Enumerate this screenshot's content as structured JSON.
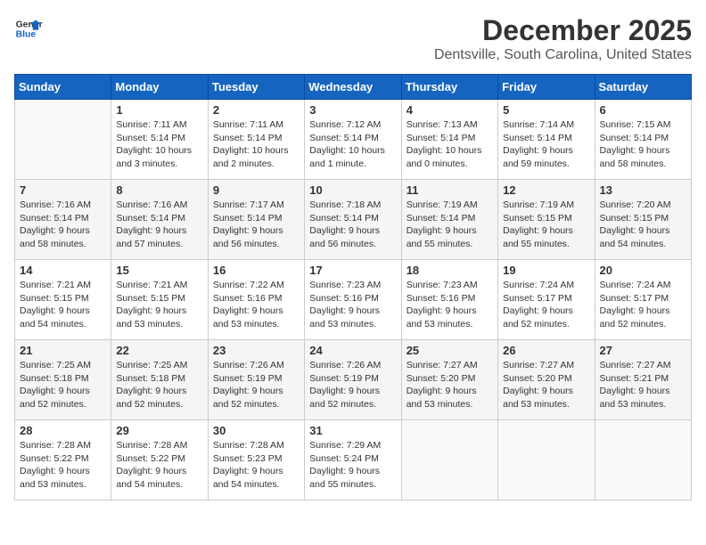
{
  "header": {
    "logo_line1": "General",
    "logo_line2": "Blue",
    "month": "December 2025",
    "location": "Dentsville, South Carolina, United States"
  },
  "days_of_week": [
    "Sunday",
    "Monday",
    "Tuesday",
    "Wednesday",
    "Thursday",
    "Friday",
    "Saturday"
  ],
  "weeks": [
    [
      {
        "day": "",
        "info": ""
      },
      {
        "day": "1",
        "info": "Sunrise: 7:11 AM\nSunset: 5:14 PM\nDaylight: 10 hours\nand 3 minutes."
      },
      {
        "day": "2",
        "info": "Sunrise: 7:11 AM\nSunset: 5:14 PM\nDaylight: 10 hours\nand 2 minutes."
      },
      {
        "day": "3",
        "info": "Sunrise: 7:12 AM\nSunset: 5:14 PM\nDaylight: 10 hours\nand 1 minute."
      },
      {
        "day": "4",
        "info": "Sunrise: 7:13 AM\nSunset: 5:14 PM\nDaylight: 10 hours\nand 0 minutes."
      },
      {
        "day": "5",
        "info": "Sunrise: 7:14 AM\nSunset: 5:14 PM\nDaylight: 9 hours\nand 59 minutes."
      },
      {
        "day": "6",
        "info": "Sunrise: 7:15 AM\nSunset: 5:14 PM\nDaylight: 9 hours\nand 58 minutes."
      }
    ],
    [
      {
        "day": "7",
        "info": "Sunrise: 7:16 AM\nSunset: 5:14 PM\nDaylight: 9 hours\nand 58 minutes."
      },
      {
        "day": "8",
        "info": "Sunrise: 7:16 AM\nSunset: 5:14 PM\nDaylight: 9 hours\nand 57 minutes."
      },
      {
        "day": "9",
        "info": "Sunrise: 7:17 AM\nSunset: 5:14 PM\nDaylight: 9 hours\nand 56 minutes."
      },
      {
        "day": "10",
        "info": "Sunrise: 7:18 AM\nSunset: 5:14 PM\nDaylight: 9 hours\nand 56 minutes."
      },
      {
        "day": "11",
        "info": "Sunrise: 7:19 AM\nSunset: 5:14 PM\nDaylight: 9 hours\nand 55 minutes."
      },
      {
        "day": "12",
        "info": "Sunrise: 7:19 AM\nSunset: 5:15 PM\nDaylight: 9 hours\nand 55 minutes."
      },
      {
        "day": "13",
        "info": "Sunrise: 7:20 AM\nSunset: 5:15 PM\nDaylight: 9 hours\nand 54 minutes."
      }
    ],
    [
      {
        "day": "14",
        "info": "Sunrise: 7:21 AM\nSunset: 5:15 PM\nDaylight: 9 hours\nand 54 minutes."
      },
      {
        "day": "15",
        "info": "Sunrise: 7:21 AM\nSunset: 5:15 PM\nDaylight: 9 hours\nand 53 minutes."
      },
      {
        "day": "16",
        "info": "Sunrise: 7:22 AM\nSunset: 5:16 PM\nDaylight: 9 hours\nand 53 minutes."
      },
      {
        "day": "17",
        "info": "Sunrise: 7:23 AM\nSunset: 5:16 PM\nDaylight: 9 hours\nand 53 minutes."
      },
      {
        "day": "18",
        "info": "Sunrise: 7:23 AM\nSunset: 5:16 PM\nDaylight: 9 hours\nand 53 minutes."
      },
      {
        "day": "19",
        "info": "Sunrise: 7:24 AM\nSunset: 5:17 PM\nDaylight: 9 hours\nand 52 minutes."
      },
      {
        "day": "20",
        "info": "Sunrise: 7:24 AM\nSunset: 5:17 PM\nDaylight: 9 hours\nand 52 minutes."
      }
    ],
    [
      {
        "day": "21",
        "info": "Sunrise: 7:25 AM\nSunset: 5:18 PM\nDaylight: 9 hours\nand 52 minutes."
      },
      {
        "day": "22",
        "info": "Sunrise: 7:25 AM\nSunset: 5:18 PM\nDaylight: 9 hours\nand 52 minutes."
      },
      {
        "day": "23",
        "info": "Sunrise: 7:26 AM\nSunset: 5:19 PM\nDaylight: 9 hours\nand 52 minutes."
      },
      {
        "day": "24",
        "info": "Sunrise: 7:26 AM\nSunset: 5:19 PM\nDaylight: 9 hours\nand 52 minutes."
      },
      {
        "day": "25",
        "info": "Sunrise: 7:27 AM\nSunset: 5:20 PM\nDaylight: 9 hours\nand 53 minutes."
      },
      {
        "day": "26",
        "info": "Sunrise: 7:27 AM\nSunset: 5:20 PM\nDaylight: 9 hours\nand 53 minutes."
      },
      {
        "day": "27",
        "info": "Sunrise: 7:27 AM\nSunset: 5:21 PM\nDaylight: 9 hours\nand 53 minutes."
      }
    ],
    [
      {
        "day": "28",
        "info": "Sunrise: 7:28 AM\nSunset: 5:22 PM\nDaylight: 9 hours\nand 53 minutes."
      },
      {
        "day": "29",
        "info": "Sunrise: 7:28 AM\nSunset: 5:22 PM\nDaylight: 9 hours\nand 54 minutes."
      },
      {
        "day": "30",
        "info": "Sunrise: 7:28 AM\nSunset: 5:23 PM\nDaylight: 9 hours\nand 54 minutes."
      },
      {
        "day": "31",
        "info": "Sunrise: 7:29 AM\nSunset: 5:24 PM\nDaylight: 9 hours\nand 55 minutes."
      },
      {
        "day": "",
        "info": ""
      },
      {
        "day": "",
        "info": ""
      },
      {
        "day": "",
        "info": ""
      }
    ]
  ]
}
